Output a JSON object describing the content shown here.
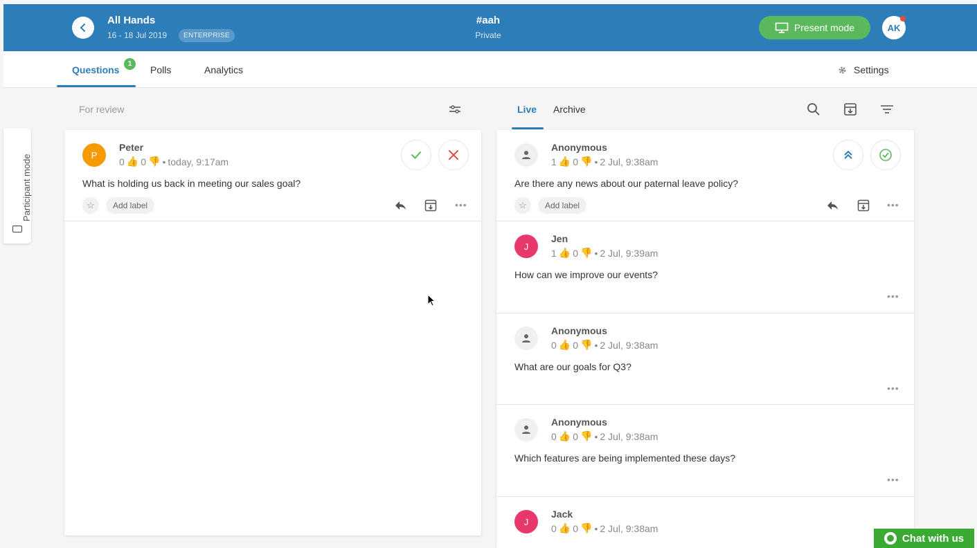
{
  "header": {
    "title": "All Hands",
    "dates": "16 - 18 Jul 2019",
    "badge": "ENTERPRISE",
    "channel": "#aah",
    "channel_sub": "Private",
    "present_label": "Present mode",
    "user_initials": "AK",
    "brand_color": "#2d7db8"
  },
  "tabs": {
    "questions": "Questions",
    "questions_count": "1",
    "polls": "Polls",
    "analytics": "Analytics",
    "settings": "Settings"
  },
  "side": {
    "participant_label": "Participant mode"
  },
  "review": {
    "title": "For review",
    "question": {
      "initial": "P",
      "name": "Peter",
      "likes": "0",
      "dislikes": "0",
      "time": "today, 9:17am",
      "text": "What is holding us back in meeting our sales goal?",
      "add_label": "Add label"
    }
  },
  "live": {
    "live_tab": "Live",
    "archive_tab": "Archive",
    "questions": [
      {
        "initial": "",
        "name": "Anonymous",
        "likes": "1",
        "dislikes": "0",
        "time": "2 Jul, 9:38am",
        "text": "Are there any news about our paternal leave policy?",
        "add_label": "Add label"
      },
      {
        "initial": "J",
        "name": "Jen",
        "likes": "1",
        "dislikes": "0",
        "time": "2 Jul, 9:39am",
        "text": "How can we improve our events?"
      },
      {
        "initial": "",
        "name": "Anonymous",
        "likes": "0",
        "dislikes": "0",
        "time": "2 Jul, 9:38am",
        "text": "What are our goals for Q3?"
      },
      {
        "initial": "",
        "name": "Anonymous",
        "likes": "0",
        "dislikes": "0",
        "time": "2 Jul, 9:38am",
        "text": "Which features are being implemented these days?"
      },
      {
        "initial": "J",
        "name": "Jack",
        "likes": "0",
        "dislikes": "0",
        "time": "2 Jul, 9:38am",
        "text": ""
      }
    ]
  },
  "chat": {
    "label": "Chat with us"
  },
  "colors": {
    "accent": "#2d7db8",
    "green": "#5cb85c",
    "red": "#e74c3c",
    "orange": "#f59b00",
    "pink": "#e8386b"
  }
}
